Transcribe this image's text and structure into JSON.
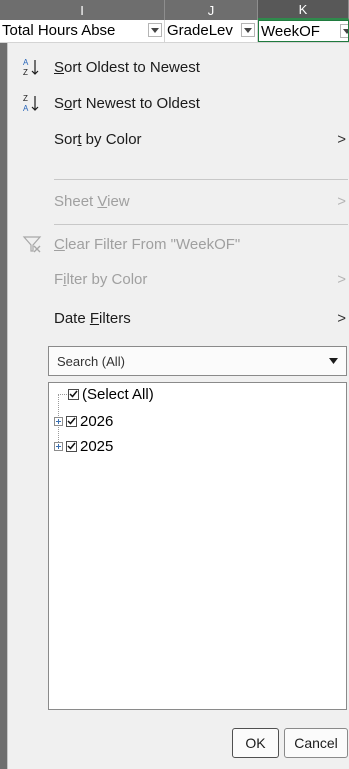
{
  "sheet": {
    "column_letters": [
      "I",
      "J",
      "K"
    ],
    "header_cells": [
      "Total Hours Abse",
      "GradeLev",
      "WeekOF"
    ]
  },
  "menu": {
    "sort_ascending": {
      "before": "",
      "key": "S",
      "after": "ort Oldest to Newest"
    },
    "sort_descending": {
      "before": "S",
      "key": "o",
      "after": "rt Newest to Oldest"
    },
    "sort_by_color": {
      "before": "Sor",
      "key": "t",
      "after": " by Color"
    },
    "sheet_view": {
      "before": "Sheet ",
      "key": "V",
      "after": "iew"
    },
    "clear_filter": {
      "before": "",
      "key": "C",
      "after": "lear Filter From \"WeekOF\""
    },
    "filter_by_color": {
      "before": "F",
      "key": "i",
      "after": "lter by Color"
    },
    "date_filters": {
      "before": "Date ",
      "key": "F",
      "after": "ilters"
    },
    "arrow": ">"
  },
  "search": {
    "placeholder": "Search (All)"
  },
  "tree": {
    "select_all": "(Select All)",
    "items": [
      "2026",
      "2025"
    ]
  },
  "buttons": {
    "ok": "OK",
    "cancel": "Cancel"
  },
  "colors": {
    "header_dark": "#6e6e6e",
    "panel_bg": "#f0f0f0",
    "active_border": "#1f7a3e"
  }
}
